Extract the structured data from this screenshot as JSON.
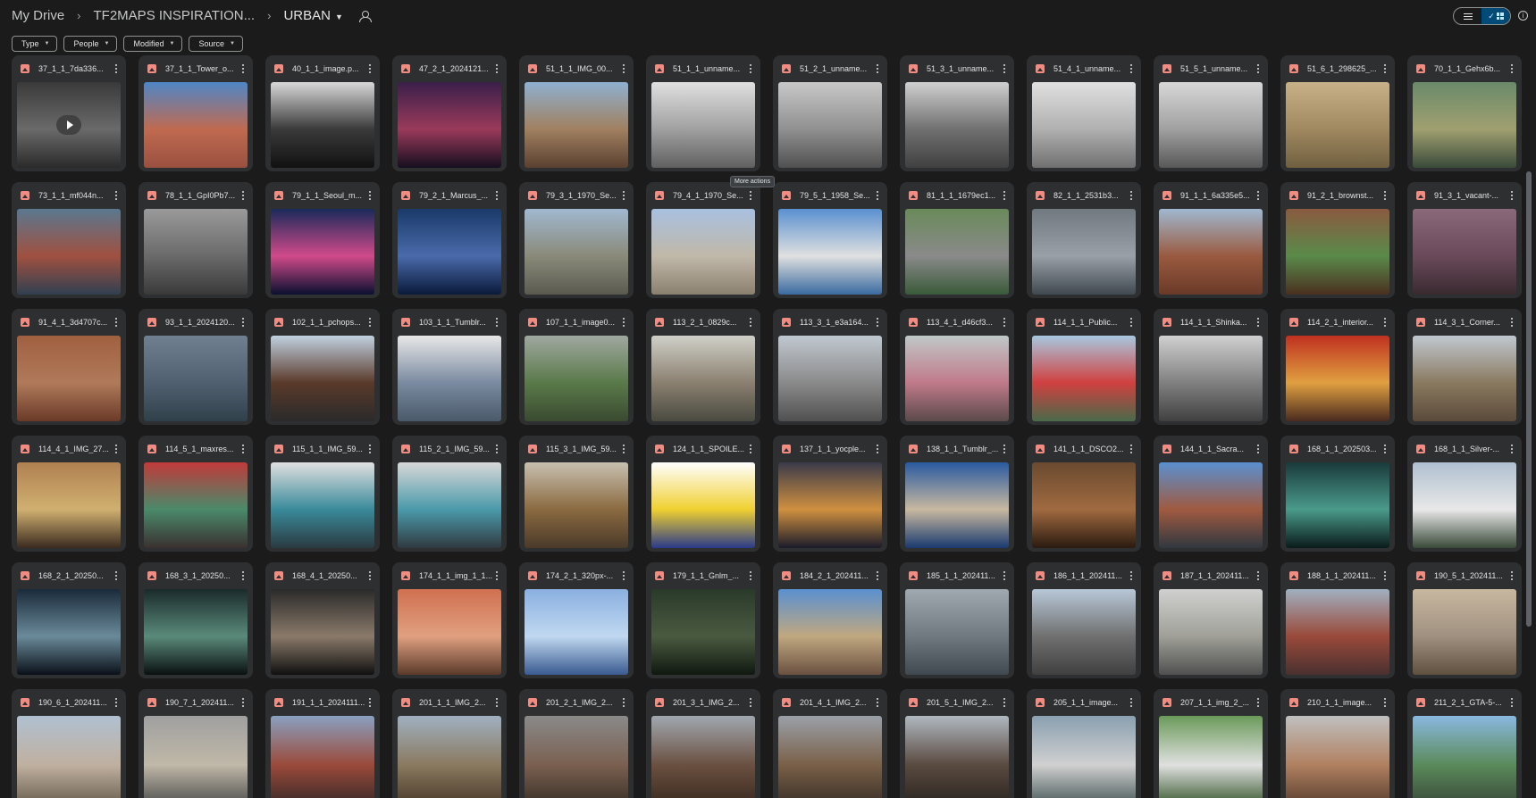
{
  "breadcrumb": {
    "root": "My Drive",
    "parent": "TF2MAPS INSPIRATION...",
    "current": "URBAN"
  },
  "filters": [
    {
      "label": "Type"
    },
    {
      "label": "People"
    },
    {
      "label": "Modified"
    },
    {
      "label": "Source"
    }
  ],
  "tooltip": "More actions",
  "files": [
    {
      "name": "37_1_1_7da336...",
      "colors": [
        "#3a3a3a",
        "#6a6a6a",
        "#2a2a2a"
      ],
      "video": true
    },
    {
      "name": "37_1_1_Tower_o...",
      "colors": [
        "#4f86c6",
        "#c06a50",
        "#9a5040"
      ]
    },
    {
      "name": "40_1_1_image.p...",
      "colors": [
        "#d8d8d8",
        "#3a3a3a",
        "#111111"
      ]
    },
    {
      "name": "47_2_1_2024121...",
      "colors": [
        "#3a1f4a",
        "#9a3a5a",
        "#150f1f"
      ]
    },
    {
      "name": "51_1_1_IMG_00...",
      "colors": [
        "#8fb0d0",
        "#a08060",
        "#5a4030"
      ]
    },
    {
      "name": "51_1_1_unname...",
      "colors": [
        "#e0e0e0",
        "#a0a0a0",
        "#606060"
      ]
    },
    {
      "name": "51_2_1_unname...",
      "colors": [
        "#c8c8c8",
        "#909090",
        "#505050"
      ]
    },
    {
      "name": "51_3_1_unname...",
      "colors": [
        "#d0d0d0",
        "#707070",
        "#404040"
      ]
    },
    {
      "name": "51_4_1_unname...",
      "colors": [
        "#e0e0e0",
        "#b0b0b0",
        "#707070"
      ]
    },
    {
      "name": "51_5_1_unname...",
      "colors": [
        "#d8d8d8",
        "#a0a0a0",
        "#585858"
      ]
    },
    {
      "name": "51_6_1_298625_...",
      "colors": [
        "#c8b088",
        "#a08860",
        "#706040"
      ]
    },
    {
      "name": "70_1_1_Gehx6b...",
      "colors": [
        "#6a8a6a",
        "#a0a070",
        "#3a4a3a"
      ]
    },
    {
      "name": "73_1_1_mf044n...",
      "colors": [
        "#5a7890",
        "#a05040",
        "#304050"
      ]
    },
    {
      "name": "78_1_1_GpI0Pb7...",
      "colors": [
        "#9a9a9a",
        "#6a6a6a",
        "#3a3a3a"
      ]
    },
    {
      "name": "79_1_1_Seoul_m...",
      "colors": [
        "#1a2a5a",
        "#d04a8a",
        "#0a1030"
      ]
    },
    {
      "name": "79_2_1_Marcus_...",
      "colors": [
        "#1a3a6a",
        "#4a6aaa",
        "#0a1a3a"
      ]
    },
    {
      "name": "79_3_1_1970_Se...",
      "colors": [
        "#a0b8d0",
        "#8a8a7a",
        "#5a5a50"
      ]
    },
    {
      "name": "79_4_1_1970_Se...",
      "colors": [
        "#a8c0e0",
        "#c0b8a8",
        "#8a8070"
      ]
    },
    {
      "name": "79_5_1_1958_Se...",
      "colors": [
        "#5a90d0",
        "#e0e0e0",
        "#3a6aa0"
      ]
    },
    {
      "name": "81_1_1_1679ec1...",
      "colors": [
        "#6a8a5a",
        "#8a8a8a",
        "#3a5a3a"
      ]
    },
    {
      "name": "82_1_1_2531b3...",
      "colors": [
        "#707880",
        "#9aa0a8",
        "#404850"
      ]
    },
    {
      "name": "91_1_1_6a335e5...",
      "colors": [
        "#a0b8d0",
        "#9a5a40",
        "#6a3a28"
      ]
    },
    {
      "name": "91_2_1_brownst...",
      "colors": [
        "#8a5a40",
        "#5a8a4a",
        "#4a3020"
      ]
    },
    {
      "name": "91_3_1_vacant-...",
      "colors": [
        "#8a6a7a",
        "#6a4a5a",
        "#3a2a30"
      ]
    },
    {
      "name": "91_4_1_3d4707c...",
      "colors": [
        "#a06040",
        "#b07a5a",
        "#6a3a28"
      ]
    },
    {
      "name": "93_1_1_2024120...",
      "colors": [
        "#708090",
        "#506070",
        "#30404a"
      ]
    },
    {
      "name": "102_1_1_pchops...",
      "colors": [
        "#c0d0e0",
        "#5a3a2a",
        "#2a2a2a"
      ]
    },
    {
      "name": "103_1_1_Tumblr...",
      "colors": [
        "#e8e8e8",
        "#7a8aa0",
        "#4a5a6a"
      ]
    },
    {
      "name": "107_1_1_image0...",
      "colors": [
        "#a0a8a0",
        "#5a7a4a",
        "#3a4a30"
      ]
    },
    {
      "name": "113_2_1_0829c...",
      "colors": [
        "#d0d0c8",
        "#8a8070",
        "#4a4a40"
      ]
    },
    {
      "name": "113_3_1_e3a164...",
      "colors": [
        "#c0c8d0",
        "#8a8a8a",
        "#505050"
      ]
    },
    {
      "name": "113_4_1_d46cf3...",
      "colors": [
        "#c0c8c8",
        "#c07a8a",
        "#5a4a4a"
      ]
    },
    {
      "name": "114_1_1_Public...",
      "colors": [
        "#a8c8e0",
        "#d04040",
        "#4a6a4a"
      ]
    },
    {
      "name": "114_1_1_Shinka...",
      "colors": [
        "#d0d0d0",
        "#808080",
        "#404040"
      ]
    },
    {
      "name": "114_2_1_interior...",
      "colors": [
        "#c03020",
        "#e0a040",
        "#4a2a20"
      ]
    },
    {
      "name": "114_3_1_Corner...",
      "colors": [
        "#c0c8d0",
        "#8a7a60",
        "#5a4a3a"
      ]
    },
    {
      "name": "114_4_1_IMG_27...",
      "colors": [
        "#b08050",
        "#d0b070",
        "#3a2a20"
      ]
    },
    {
      "name": "114_5_1_maxres...",
      "colors": [
        "#c03a3a",
        "#4a8a6a",
        "#3a3030"
      ]
    },
    {
      "name": "115_1_1_IMG_59...",
      "colors": [
        "#e0e0e0",
        "#3a8a9a",
        "#2a3a40"
      ]
    },
    {
      "name": "115_2_1_IMG_59...",
      "colors": [
        "#d8d8d8",
        "#4a9aaa",
        "#303a40"
      ]
    },
    {
      "name": "115_3_1_IMG_59...",
      "colors": [
        "#c8c0b0",
        "#8a6a40",
        "#4a3a2a"
      ]
    },
    {
      "name": "124_1_1_SPOILE...",
      "colors": [
        "#ffffff",
        "#f0d030",
        "#2a3a8a"
      ]
    },
    {
      "name": "137_1_1_yocple...",
      "colors": [
        "#3a3a4a",
        "#d09040",
        "#1a1a2a"
      ]
    },
    {
      "name": "138_1_1_Tumblr_...",
      "colors": [
        "#2a5aa0",
        "#c8b8a0",
        "#1a3a70"
      ]
    },
    {
      "name": "141_1_1_DSCO2...",
      "colors": [
        "#6a4a30",
        "#a06a40",
        "#2a1a10"
      ]
    },
    {
      "name": "144_1_1_Sacra...",
      "colors": [
        "#5a90d0",
        "#a05a40",
        "#303840"
      ]
    },
    {
      "name": "168_1_1_202503...",
      "colors": [
        "#1a3a3a",
        "#4a9a8a",
        "#0a1a1a"
      ]
    },
    {
      "name": "168_1_1_Silver-...",
      "colors": [
        "#b0c0d0",
        "#e8e8e8",
        "#3a4a3a"
      ]
    },
    {
      "name": "168_2_1_20250...",
      "colors": [
        "#1a2a3a",
        "#6a8a9a",
        "#0a1018"
      ]
    },
    {
      "name": "168_3_1_20250...",
      "colors": [
        "#1a2a2a",
        "#5a8a7a",
        "#0a1010"
      ]
    },
    {
      "name": "168_4_1_20250...",
      "colors": [
        "#2a2a2a",
        "#8a7a6a",
        "#101010"
      ]
    },
    {
      "name": "174_1_1_img_1_1...",
      "colors": [
        "#d07050",
        "#e0a080",
        "#5a3a2a"
      ]
    },
    {
      "name": "174_2_1_320px-...",
      "colors": [
        "#8ab0e0",
        "#c0d8f0",
        "#3a5a90"
      ]
    },
    {
      "name": "179_1_1_Gnlm_...",
      "colors": [
        "#2a3a2a",
        "#4a5a40",
        "#101810"
      ]
    },
    {
      "name": "184_2_1_202411...",
      "colors": [
        "#5a90d0",
        "#c0a880",
        "#6a5040"
      ]
    },
    {
      "name": "185_1_1_202411...",
      "colors": [
        "#a0a8b0",
        "#707880",
        "#404850"
      ]
    },
    {
      "name": "186_1_1_202411...",
      "colors": [
        "#b8c8d8",
        "#707070",
        "#404040"
      ]
    },
    {
      "name": "187_1_1_202411...",
      "colors": [
        "#d0d0d0",
        "#a0a098",
        "#505050"
      ]
    },
    {
      "name": "188_1_1_202411...",
      "colors": [
        "#a0b0c0",
        "#9a4a3a",
        "#4a3030"
      ]
    },
    {
      "name": "190_5_1_202411...",
      "colors": [
        "#c8b8a0",
        "#a09080",
        "#605040"
      ]
    },
    {
      "name": "190_6_1_202411...",
      "colors": [
        "#b0c0d0",
        "#c0b0a0",
        "#6a6050"
      ]
    },
    {
      "name": "190_7_1_202411...",
      "colors": [
        "#a0a0a0",
        "#c0b8a8",
        "#505050"
      ]
    },
    {
      "name": "191_1_1_2024111...",
      "colors": [
        "#8aa0c0",
        "#9a4a3a",
        "#3a2a28"
      ]
    },
    {
      "name": "201_1_1_IMG_2...",
      "colors": [
        "#a0b0c0",
        "#8a7a60",
        "#4a3a2a"
      ]
    },
    {
      "name": "201_2_1_IMG_2...",
      "colors": [
        "#8a8a8a",
        "#7a6050",
        "#3a3028"
      ]
    },
    {
      "name": "201_3_1_IMG_2...",
      "colors": [
        "#a0a8b0",
        "#6a5040",
        "#3a2a20"
      ]
    },
    {
      "name": "201_4_1_IMG_2...",
      "colors": [
        "#9aa0a8",
        "#7a6048",
        "#3a3028"
      ]
    },
    {
      "name": "201_5_1_IMG_2...",
      "colors": [
        "#b0b8c0",
        "#5a4a40",
        "#2a2520"
      ]
    },
    {
      "name": "205_1_1_image...",
      "colors": [
        "#8aa0b0",
        "#d0d0d0",
        "#4a5a5a"
      ]
    },
    {
      "name": "207_1_1_img_2_...",
      "colors": [
        "#6a9a5a",
        "#e0e0e0",
        "#3a5a30"
      ]
    },
    {
      "name": "210_1_1_image...",
      "colors": [
        "#c0c0c0",
        "#b08060",
        "#5a4030"
      ]
    },
    {
      "name": "211_2_1_GTA-5-...",
      "colors": [
        "#8ab8e0",
        "#5a8a5a",
        "#3a4a3a"
      ]
    }
  ]
}
